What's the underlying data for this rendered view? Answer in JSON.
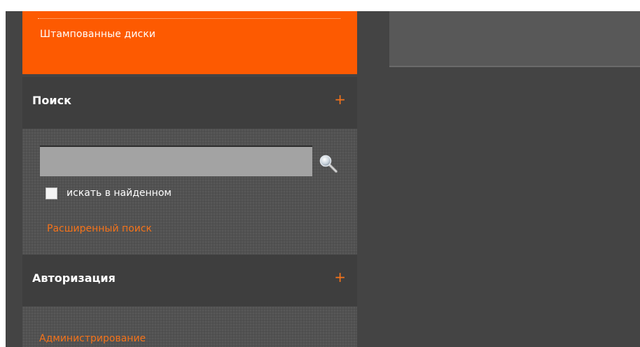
{
  "menu": {
    "item_label": "Штампованные диски"
  },
  "search": {
    "title": "Поиск",
    "toggle": "+",
    "input_value": "",
    "checkbox_label": "искать в найденном",
    "checkbox_checked": false,
    "advanced_link": "Расширенный поиск",
    "search_icon": "magnifier-icon"
  },
  "auth": {
    "title": "Авторизация",
    "toggle": "+",
    "admin_link": "Администрирование"
  },
  "colors": {
    "accent": "#fd5a01",
    "link": "#f5731a",
    "background": "#444444"
  }
}
